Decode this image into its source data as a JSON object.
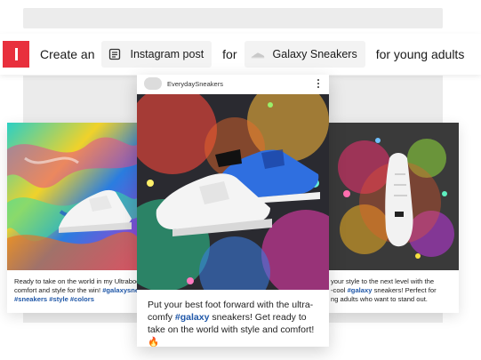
{
  "prompt": {
    "create": "Create an",
    "post_type": "Instagram post",
    "for": "for",
    "brand": "Galaxy Sneakers",
    "audience": "for young adults"
  },
  "posts": {
    "left": {
      "caption_parts": [
        "Ready to take on the world in my Ultraboo",
        "comfort and style for the win! ",
        "#galaxysne",
        "#sneakers #style #colors"
      ]
    },
    "center": {
      "handle": "EverydaySneakers",
      "caption_a": "Put your best foot forward with the ultra-comfy ",
      "tag": "#galaxy",
      "caption_b": " sneakers! Get ready to take on the world with style and comfort! 🔥"
    },
    "right": {
      "caption_parts": [
        "your style to the next level with the",
        "-cool ",
        "#galaxy",
        " sneakers! Perfect for",
        "ng adults who want to stand out."
      ]
    }
  },
  "colors": {
    "accent": "#e8303d",
    "hashtag": "#1f57a8",
    "panel": "#ebebeb"
  },
  "icons": {
    "post_type": "document-icon",
    "brand": "sneaker-thumbnail-icon",
    "menu": "more-vertical-icon"
  }
}
